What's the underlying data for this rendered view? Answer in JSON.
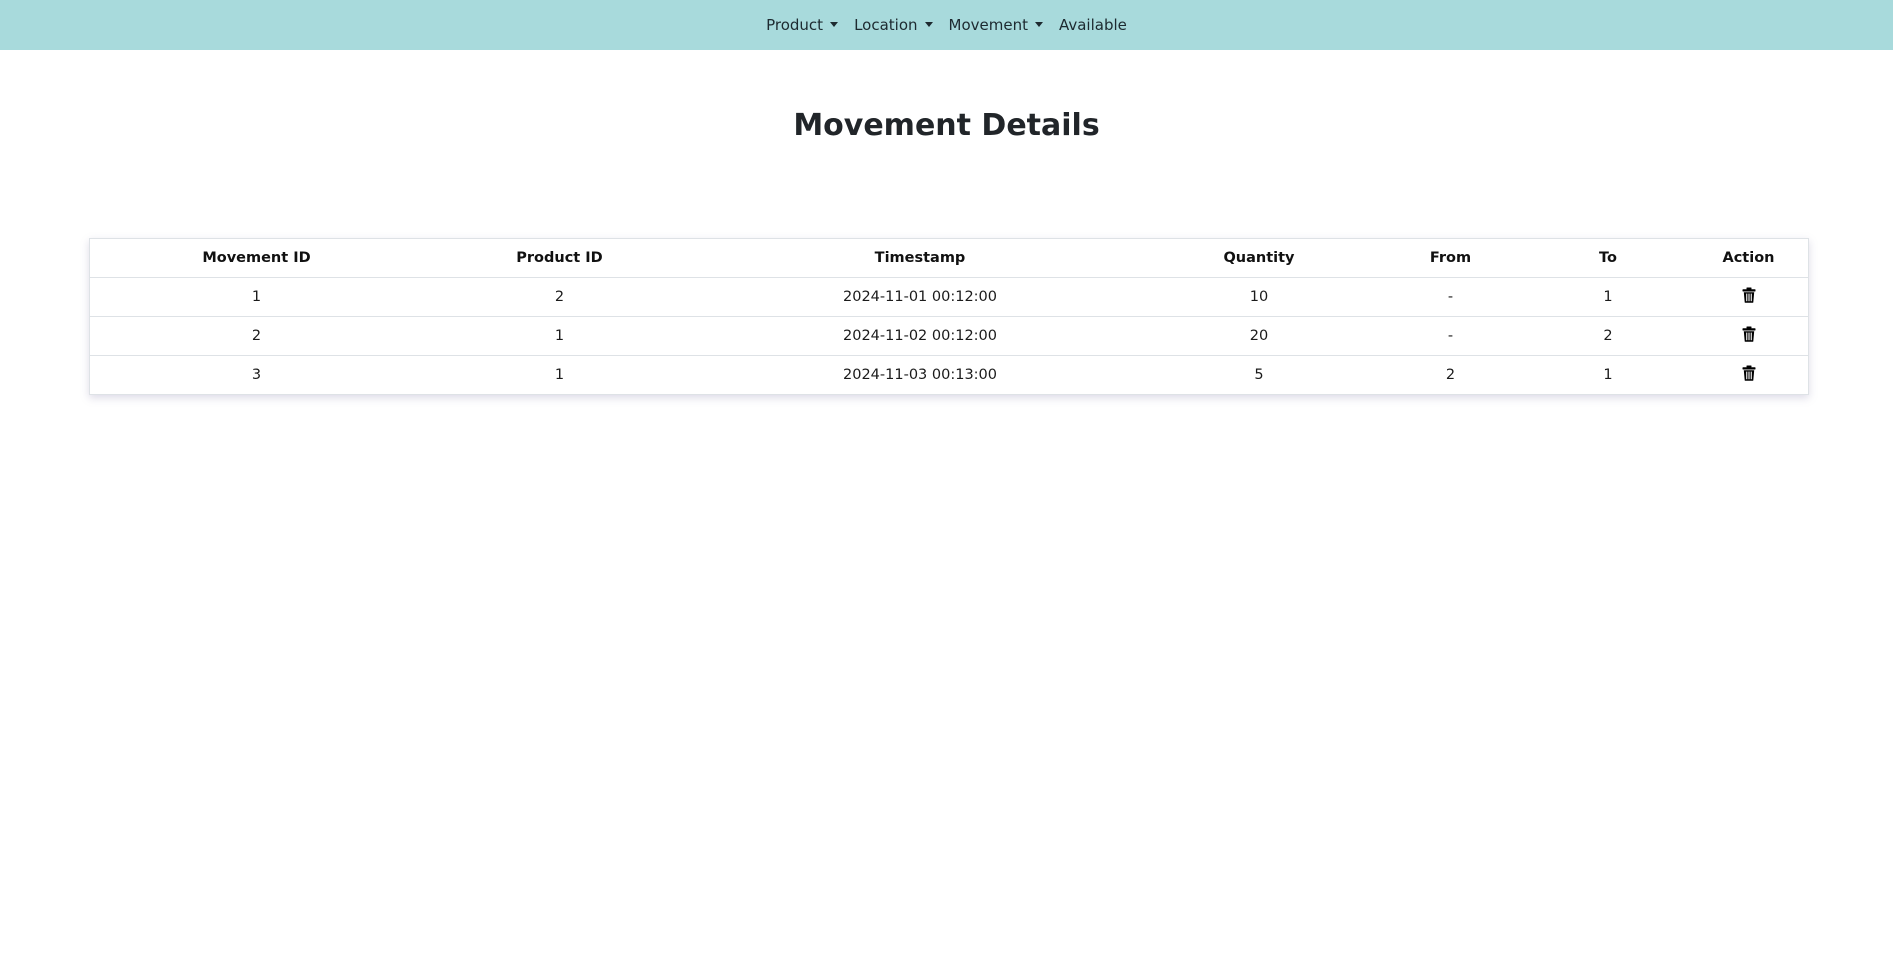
{
  "nav": {
    "items": [
      {
        "label": "Product",
        "dropdown": true
      },
      {
        "label": "Location",
        "dropdown": true
      },
      {
        "label": "Movement",
        "dropdown": true
      },
      {
        "label": "Available",
        "dropdown": false
      }
    ]
  },
  "page": {
    "title": "Movement Details"
  },
  "table": {
    "headers": [
      "Movement ID",
      "Product ID",
      "Timestamp",
      "Quantity",
      "From",
      "To",
      "Action"
    ],
    "rows": [
      {
        "movement_id": "1",
        "product_id": "2",
        "timestamp": "2024-11-01 00:12:00",
        "quantity": "10",
        "from": "-",
        "to": "1",
        "action_icon": "trash-icon"
      },
      {
        "movement_id": "2",
        "product_id": "1",
        "timestamp": "2024-11-02 00:12:00",
        "quantity": "20",
        "from": "-",
        "to": "2",
        "action_icon": "trash-icon"
      },
      {
        "movement_id": "3",
        "product_id": "1",
        "timestamp": "2024-11-03 00:13:00",
        "quantity": "5",
        "from": "2",
        "to": "1",
        "action_icon": "trash-icon"
      }
    ]
  },
  "colors": {
    "navbar_bg": "#a8dadc",
    "text": "#212529",
    "border": "#dee2e6"
  }
}
